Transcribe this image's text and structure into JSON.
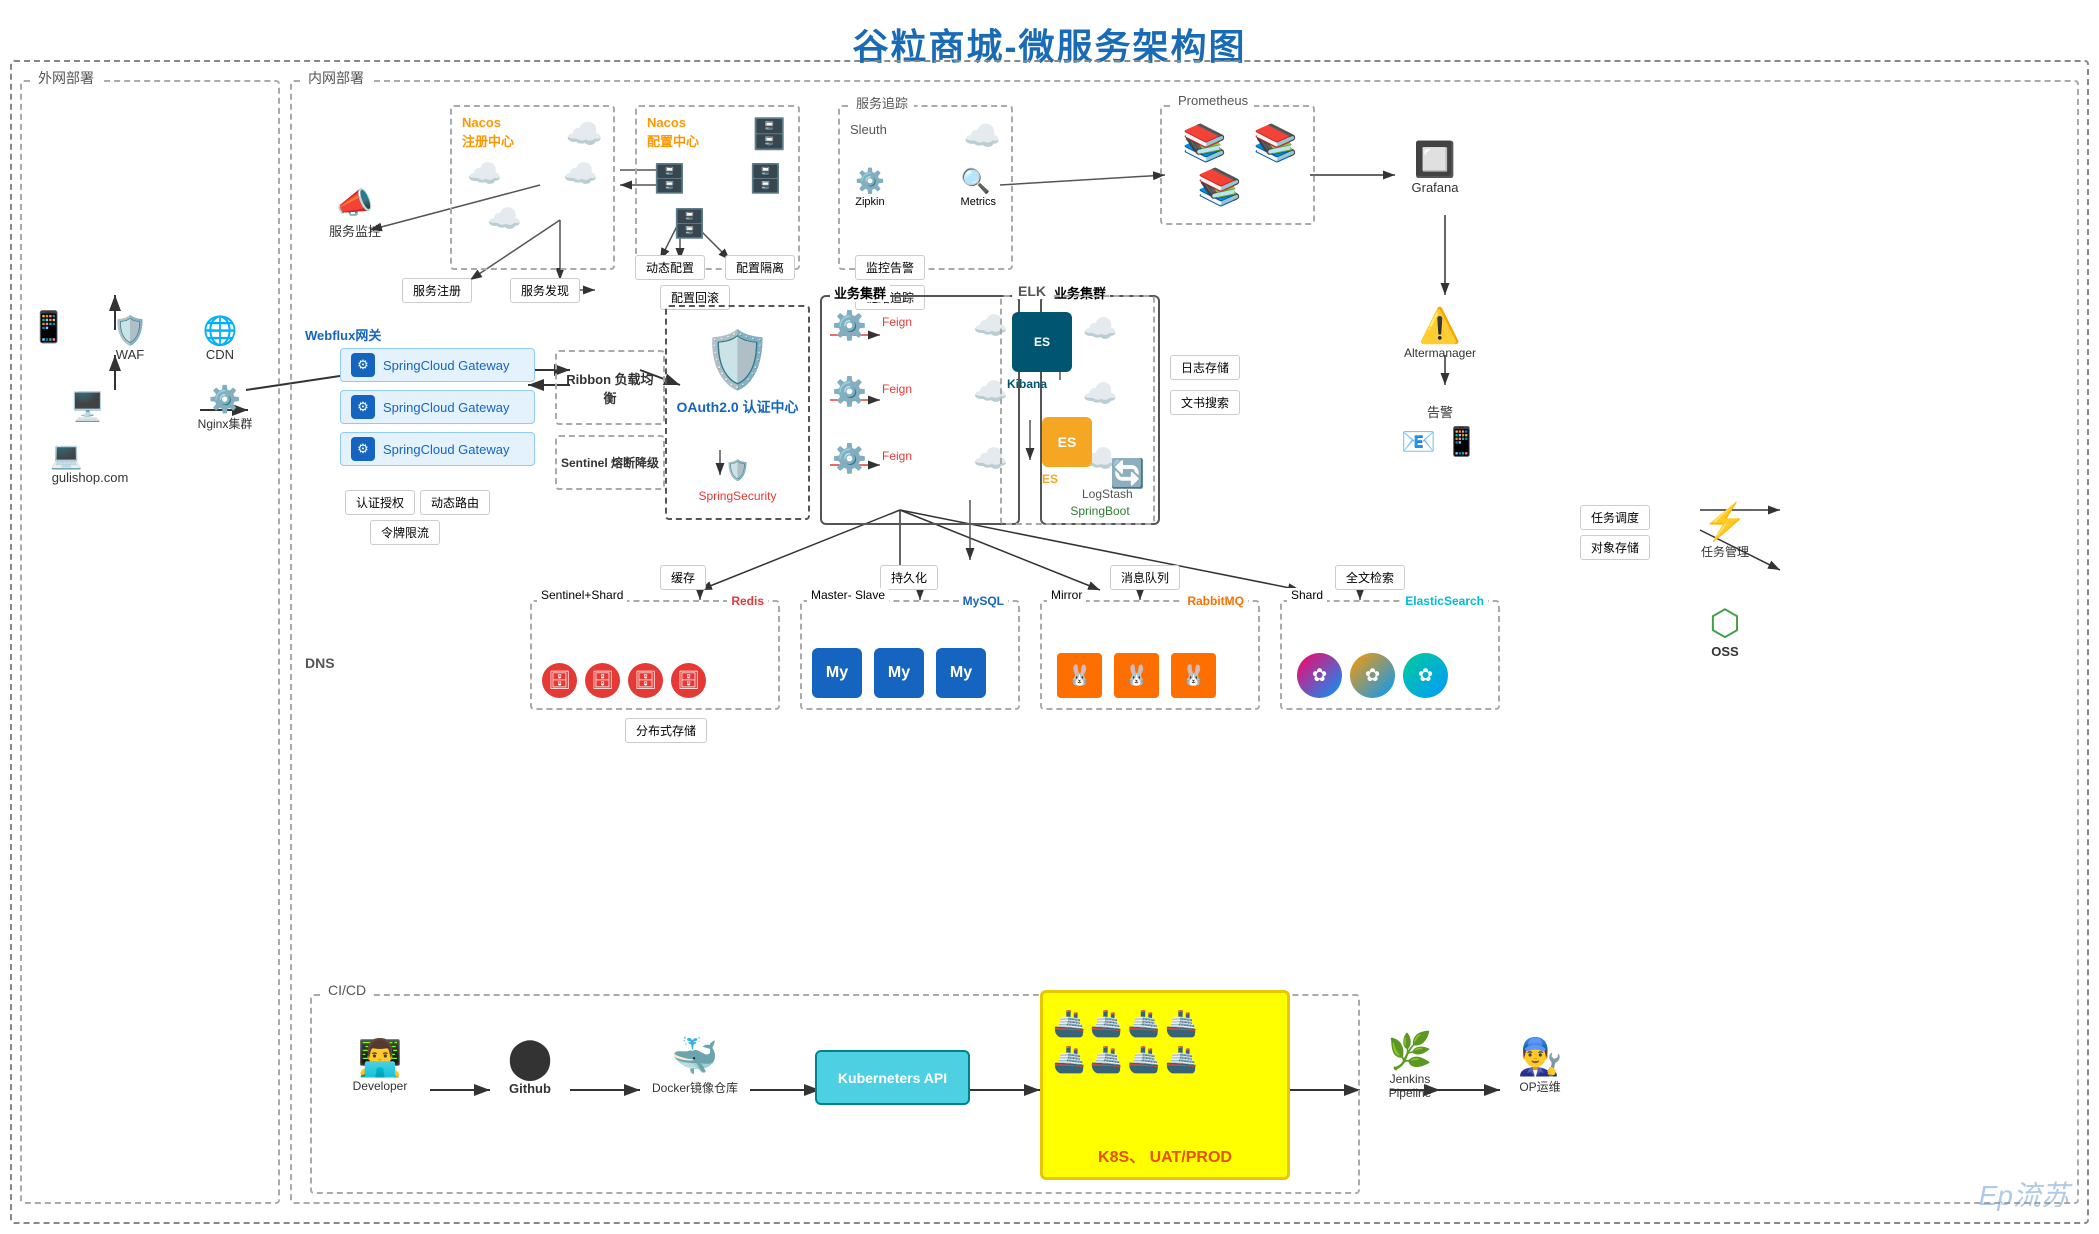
{
  "title": "谷粒商城-微服务架构图",
  "zones": {
    "external": "外网部署",
    "internal": "内网部署",
    "cicd": "CI/CD"
  },
  "external_items": {
    "gulishop": "gulishop.com",
    "waf": "WAF",
    "cdn": "CDN",
    "nginx": "Nginx集群"
  },
  "nacos_registry": {
    "label": "Nacos",
    "sublabel": "注册中心"
  },
  "nacos_config": {
    "label": "Nacos",
    "sublabel": "配置中心"
  },
  "service_monitor": "服务监控",
  "service_register": "服务注册",
  "service_discover": "服务发现",
  "dynamic_config": "动态配置",
  "config_isolation": "配置隔离",
  "config_rollback": "配置回滚",
  "monitor_alert": "监控告警",
  "chain_trace": "链路追踪",
  "service_trace": "服务追踪",
  "sleuth": "Sleuth",
  "zipkin": "Zipkin",
  "metrics": "Metrics",
  "prometheus": "Prometheus",
  "grafana": "Grafana",
  "altermanager": "Altermanager",
  "alert": "告警",
  "webflux": "Webflux网关",
  "gateways": [
    "SpringCloud Gateway",
    "SpringCloud Gateway",
    "SpringCloud Gateway"
  ],
  "ribbon": "Ribbon\n负载均衡",
  "sentinel": "Sentinel\n熔断降级",
  "oauth": "OAuth2.0\n认证中心",
  "spring_security": "SpringSecurity",
  "feign": "Feign",
  "springboot": "SpringBoot",
  "business_cluster": "业务集群",
  "auth_grant": "认证授权",
  "dynamic_route": "动态路由",
  "token_limit": "令牌限流",
  "elk": "ELK",
  "kibana": "Kibana",
  "es": "ES",
  "logstash": "LogStash",
  "log_store": "日志存储",
  "fulltext_search_elk": "文书搜索",
  "cache": "缓存",
  "persist": "持久化",
  "mq": "消息队列",
  "fulltext_search": "全文检索",
  "sentinel_shard": "Sentinel+Shard",
  "redis": "Redis",
  "dist_storage": "分布式存储",
  "master_slave": "Master-\nSlave",
  "mysql": "MySQL",
  "mirror": "Mirror",
  "rabbitmq": "RabbitMQ",
  "shard": "Shard",
  "elasticsearch": "ElasticSearch",
  "task_schedule": "任务调度",
  "object_storage": "对象存储",
  "task_manager": "任务管理",
  "oss": "OSS",
  "dns": "DNS",
  "developer": "Developer",
  "github": "Github",
  "docker_repo": "Docker镜像仓库",
  "kubernetes_api": "Kuberneters API",
  "k8s_uat": "K8S、\nUAT/PROD",
  "jenkins": "Jenkins\nPipeline",
  "op": "OP运维",
  "watermark": "Ep流苏"
}
